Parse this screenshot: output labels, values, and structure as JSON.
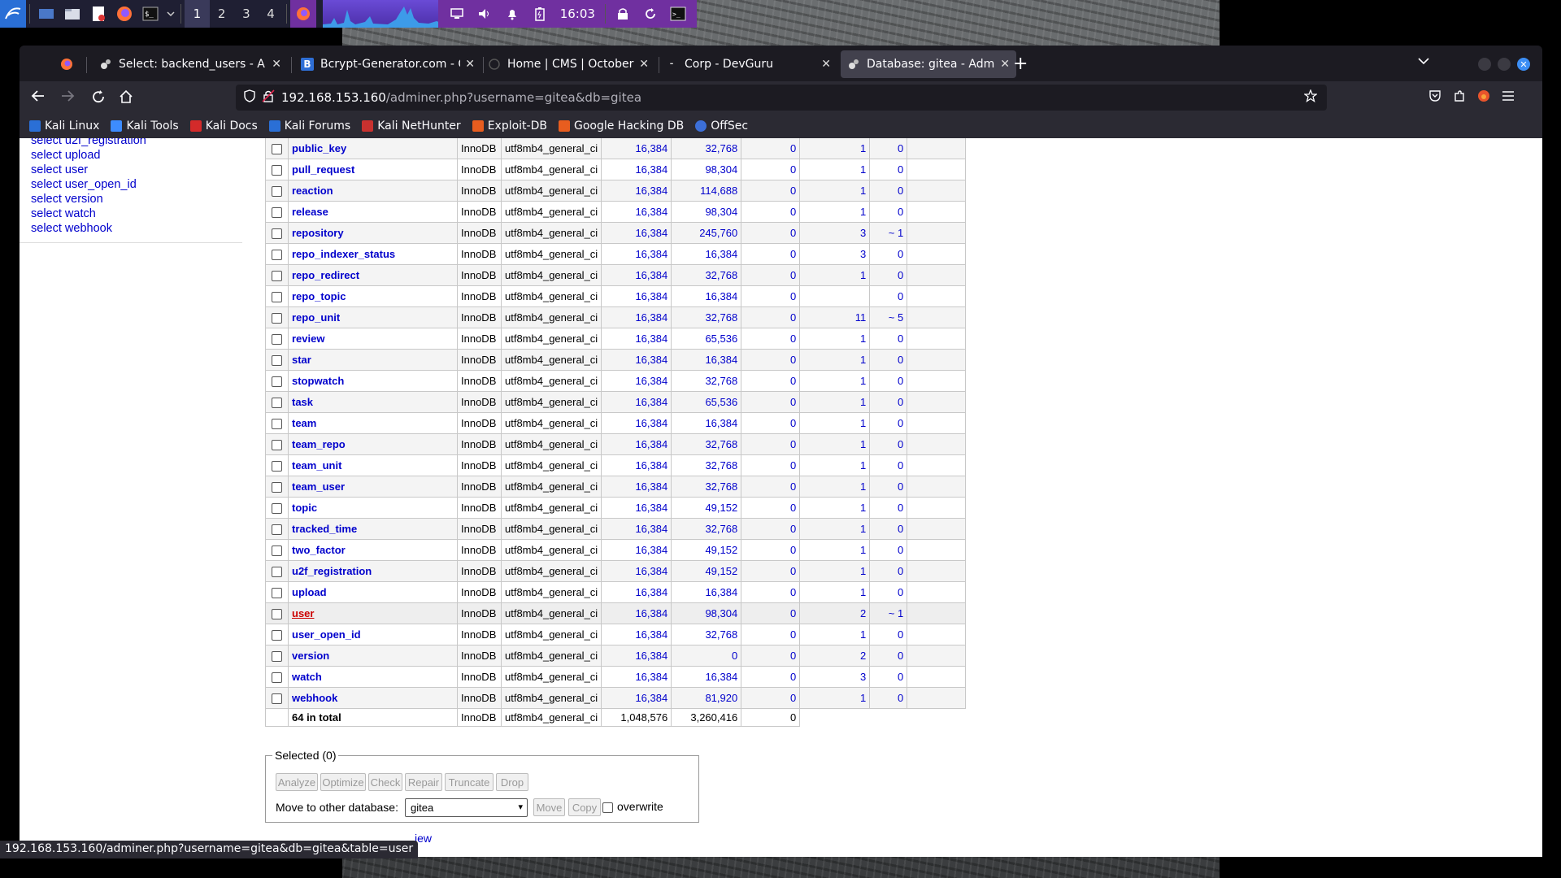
{
  "desktop": {
    "workspaces": [
      "1",
      "2",
      "3",
      "4"
    ],
    "clock": "16:03",
    "panel_icons": [
      "kali-menu-icon",
      "show-desktop-icon",
      "file-manager-icon",
      "text-editor-icon",
      "firefox-icon",
      "terminal-icon",
      "chevron-down-icon"
    ],
    "tray_icons": [
      "firefox-task-icon",
      "monitor-icon",
      "volume-icon",
      "notification-icon",
      "battery-icon",
      "lock-icon",
      "refresh-icon",
      "terminal-tray-icon"
    ]
  },
  "browser": {
    "tabs": [
      {
        "title": "Select: backend_users - A",
        "active": false
      },
      {
        "title": "Bcrypt-Generator.com - C",
        "active": false
      },
      {
        "title": "Home | CMS | OctoberCMS",
        "active": false
      },
      {
        "title": "Corp - DevGuru",
        "active": false
      },
      {
        "title": "Database: gitea - Adminer",
        "active": true
      }
    ],
    "url_host": "192.168.153.160",
    "url_path": "/adminer.php?username=gitea&db=gitea",
    "bookmarks": [
      "Kali Linux",
      "Kali Tools",
      "Kali Docs",
      "Kali Forums",
      "Kali NetHunter",
      "Exploit-DB",
      "Google Hacking DB",
      "OffSec"
    ],
    "status_url": "192.168.153.160/adminer.php?username=gitea&db=gitea&table=user"
  },
  "sidebar": {
    "links": [
      "select u2f_registration",
      "select upload",
      "select user",
      "select user_open_id",
      "select version",
      "select watch",
      "select webhook"
    ]
  },
  "table": {
    "rows": [
      {
        "name": "public_key",
        "engine": "InnoDB",
        "collation": "utf8mb4_general_ci",
        "data_length": "16,384",
        "index_length": "32,768",
        "data_free": "0",
        "auto_inc": "1",
        "rows": "0"
      },
      {
        "name": "pull_request",
        "engine": "InnoDB",
        "collation": "utf8mb4_general_ci",
        "data_length": "16,384",
        "index_length": "98,304",
        "data_free": "0",
        "auto_inc": "1",
        "rows": "0"
      },
      {
        "name": "reaction",
        "engine": "InnoDB",
        "collation": "utf8mb4_general_ci",
        "data_length": "16,384",
        "index_length": "114,688",
        "data_free": "0",
        "auto_inc": "1",
        "rows": "0"
      },
      {
        "name": "release",
        "engine": "InnoDB",
        "collation": "utf8mb4_general_ci",
        "data_length": "16,384",
        "index_length": "98,304",
        "data_free": "0",
        "auto_inc": "1",
        "rows": "0"
      },
      {
        "name": "repository",
        "engine": "InnoDB",
        "collation": "utf8mb4_general_ci",
        "data_length": "16,384",
        "index_length": "245,760",
        "data_free": "0",
        "auto_inc": "3",
        "rows": "~ 1"
      },
      {
        "name": "repo_indexer_status",
        "engine": "InnoDB",
        "collation": "utf8mb4_general_ci",
        "data_length": "16,384",
        "index_length": "16,384",
        "data_free": "0",
        "auto_inc": "3",
        "rows": "0"
      },
      {
        "name": "repo_redirect",
        "engine": "InnoDB",
        "collation": "utf8mb4_general_ci",
        "data_length": "16,384",
        "index_length": "32,768",
        "data_free": "0",
        "auto_inc": "1",
        "rows": "0"
      },
      {
        "name": "repo_topic",
        "engine": "InnoDB",
        "collation": "utf8mb4_general_ci",
        "data_length": "16,384",
        "index_length": "16,384",
        "data_free": "0",
        "auto_inc": "",
        "rows": "0"
      },
      {
        "name": "repo_unit",
        "engine": "InnoDB",
        "collation": "utf8mb4_general_ci",
        "data_length": "16,384",
        "index_length": "32,768",
        "data_free": "0",
        "auto_inc": "11",
        "rows": "~ 5"
      },
      {
        "name": "review",
        "engine": "InnoDB",
        "collation": "utf8mb4_general_ci",
        "data_length": "16,384",
        "index_length": "65,536",
        "data_free": "0",
        "auto_inc": "1",
        "rows": "0"
      },
      {
        "name": "star",
        "engine": "InnoDB",
        "collation": "utf8mb4_general_ci",
        "data_length": "16,384",
        "index_length": "16,384",
        "data_free": "0",
        "auto_inc": "1",
        "rows": "0"
      },
      {
        "name": "stopwatch",
        "engine": "InnoDB",
        "collation": "utf8mb4_general_ci",
        "data_length": "16,384",
        "index_length": "32,768",
        "data_free": "0",
        "auto_inc": "1",
        "rows": "0"
      },
      {
        "name": "task",
        "engine": "InnoDB",
        "collation": "utf8mb4_general_ci",
        "data_length": "16,384",
        "index_length": "65,536",
        "data_free": "0",
        "auto_inc": "1",
        "rows": "0"
      },
      {
        "name": "team",
        "engine": "InnoDB",
        "collation": "utf8mb4_general_ci",
        "data_length": "16,384",
        "index_length": "16,384",
        "data_free": "0",
        "auto_inc": "1",
        "rows": "0"
      },
      {
        "name": "team_repo",
        "engine": "InnoDB",
        "collation": "utf8mb4_general_ci",
        "data_length": "16,384",
        "index_length": "32,768",
        "data_free": "0",
        "auto_inc": "1",
        "rows": "0"
      },
      {
        "name": "team_unit",
        "engine": "InnoDB",
        "collation": "utf8mb4_general_ci",
        "data_length": "16,384",
        "index_length": "32,768",
        "data_free": "0",
        "auto_inc": "1",
        "rows": "0"
      },
      {
        "name": "team_user",
        "engine": "InnoDB",
        "collation": "utf8mb4_general_ci",
        "data_length": "16,384",
        "index_length": "32,768",
        "data_free": "0",
        "auto_inc": "1",
        "rows": "0"
      },
      {
        "name": "topic",
        "engine": "InnoDB",
        "collation": "utf8mb4_general_ci",
        "data_length": "16,384",
        "index_length": "49,152",
        "data_free": "0",
        "auto_inc": "1",
        "rows": "0"
      },
      {
        "name": "tracked_time",
        "engine": "InnoDB",
        "collation": "utf8mb4_general_ci",
        "data_length": "16,384",
        "index_length": "32,768",
        "data_free": "0",
        "auto_inc": "1",
        "rows": "0"
      },
      {
        "name": "two_factor",
        "engine": "InnoDB",
        "collation": "utf8mb4_general_ci",
        "data_length": "16,384",
        "index_length": "49,152",
        "data_free": "0",
        "auto_inc": "1",
        "rows": "0"
      },
      {
        "name": "u2f_registration",
        "engine": "InnoDB",
        "collation": "utf8mb4_general_ci",
        "data_length": "16,384",
        "index_length": "49,152",
        "data_free": "0",
        "auto_inc": "1",
        "rows": "0"
      },
      {
        "name": "upload",
        "engine": "InnoDB",
        "collation": "utf8mb4_general_ci",
        "data_length": "16,384",
        "index_length": "16,384",
        "data_free": "0",
        "auto_inc": "1",
        "rows": "0"
      },
      {
        "name": "user",
        "engine": "InnoDB",
        "collation": "utf8mb4_general_ci",
        "data_length": "16,384",
        "index_length": "98,304",
        "data_free": "0",
        "auto_inc": "2",
        "rows": "~ 1",
        "visited": true
      },
      {
        "name": "user_open_id",
        "engine": "InnoDB",
        "collation": "utf8mb4_general_ci",
        "data_length": "16,384",
        "index_length": "32,768",
        "data_free": "0",
        "auto_inc": "1",
        "rows": "0"
      },
      {
        "name": "version",
        "engine": "InnoDB",
        "collation": "utf8mb4_general_ci",
        "data_length": "16,384",
        "index_length": "0",
        "data_free": "0",
        "auto_inc": "2",
        "rows": "0"
      },
      {
        "name": "watch",
        "engine": "InnoDB",
        "collation": "utf8mb4_general_ci",
        "data_length": "16,384",
        "index_length": "16,384",
        "data_free": "0",
        "auto_inc": "3",
        "rows": "0"
      },
      {
        "name": "webhook",
        "engine": "InnoDB",
        "collation": "utf8mb4_general_ci",
        "data_length": "16,384",
        "index_length": "81,920",
        "data_free": "0",
        "auto_inc": "1",
        "rows": "0"
      }
    ],
    "total": {
      "label": "64 in total",
      "engine": "InnoDB",
      "collation": "utf8mb4_general_ci",
      "data_length": "1,048,576",
      "index_length": "3,260,416",
      "data_free": "0"
    }
  },
  "selected": {
    "legend": "Selected (0)",
    "buttons": [
      "Analyze",
      "Optimize",
      "Check",
      "Repair",
      "Truncate",
      "Drop"
    ],
    "move_label": "Move to other database:",
    "db_value": "gitea",
    "move_button": "Move",
    "copy_button": "Copy",
    "overwrite_label": "overwrite"
  },
  "footer_link": "iew"
}
